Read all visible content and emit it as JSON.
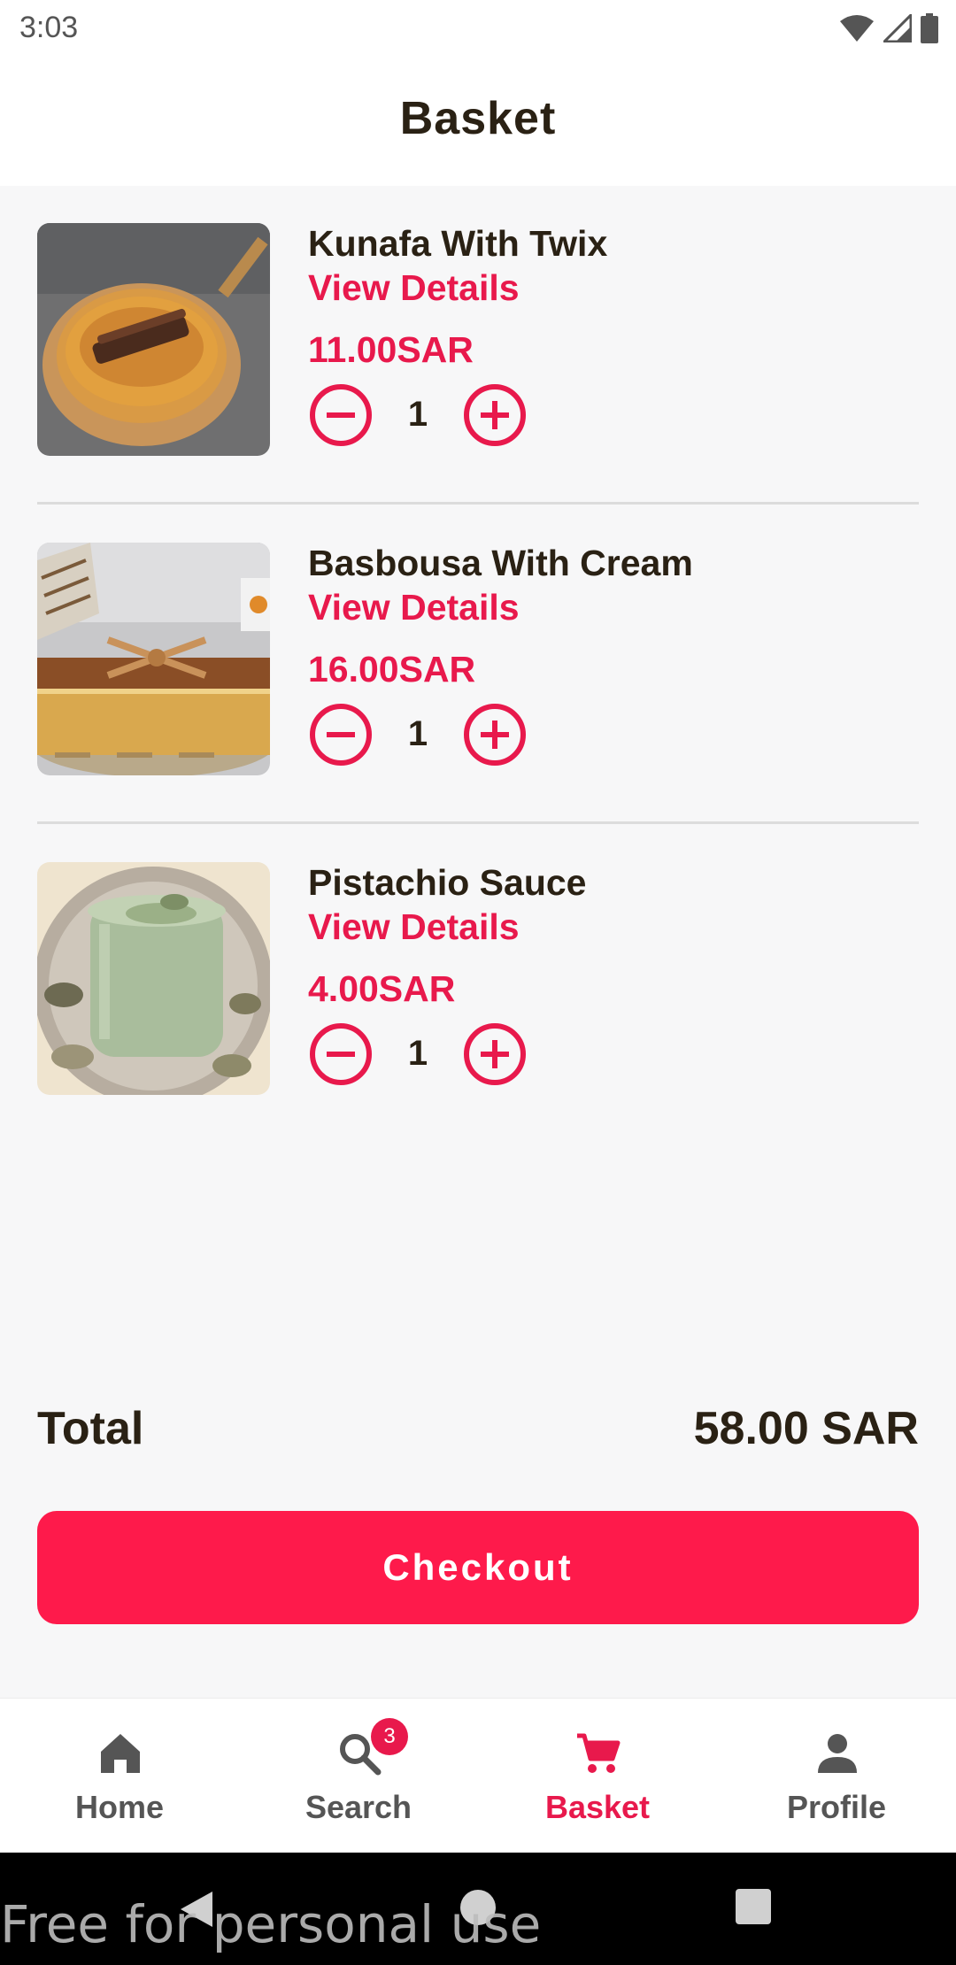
{
  "status_bar": {
    "time": "3:03",
    "icons": [
      "wifi-icon",
      "signal-icon",
      "battery-icon"
    ]
  },
  "header": {
    "title": "Basket"
  },
  "items": [
    {
      "name": "Kunafa With Twix",
      "details_link": "View Details",
      "price": "11.00SAR",
      "quantity": "1"
    },
    {
      "name": "Basbousa With Cream",
      "details_link": "View Details",
      "price": "16.00SAR",
      "quantity": "1"
    },
    {
      "name": "Pistachio Sauce",
      "details_link": "View Details",
      "price": "4.00SAR",
      "quantity": "1"
    }
  ],
  "summary": {
    "total_label": "Total",
    "total_value": "58.00 SAR"
  },
  "checkout": {
    "label": "Checkout"
  },
  "bottom_nav": {
    "items": [
      {
        "label": "Home",
        "icon": "home-icon"
      },
      {
        "label": "Search",
        "icon": "search-icon"
      },
      {
        "label": "Basket",
        "icon": "cart-icon",
        "active": true,
        "badge": "3"
      },
      {
        "label": "Profile",
        "icon": "person-icon"
      }
    ]
  },
  "watermark": "Free for personal use",
  "colors": {
    "accent": "#e8194c",
    "button": "#fe1a4b",
    "text": "#2a2114",
    "background": "#f7f7f8"
  }
}
